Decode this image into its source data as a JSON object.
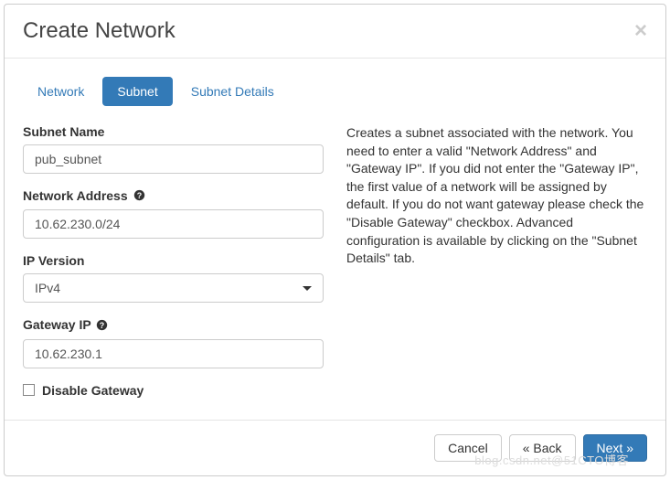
{
  "modal": {
    "title": "Create Network"
  },
  "tabs": {
    "network": "Network",
    "subnet": "Subnet",
    "subnet_details": "Subnet Details"
  },
  "form": {
    "subnet_name": {
      "label": "Subnet Name",
      "value": "pub_subnet"
    },
    "network_address": {
      "label": "Network Address",
      "value": "10.62.230.0/24"
    },
    "ip_version": {
      "label": "IP Version",
      "value": "IPv4"
    },
    "gateway_ip": {
      "label": "Gateway IP",
      "value": "10.62.230.1"
    },
    "disable_gateway": {
      "label": "Disable Gateway"
    }
  },
  "help_text": "Creates a subnet associated with the network. You need to enter a valid \"Network Address\" and \"Gateway IP\". If you did not enter the \"Gateway IP\", the first value of a network will be assigned by default. If you do not want gateway please check the \"Disable Gateway\" checkbox. Advanced configuration is available by clicking on the \"Subnet Details\" tab.",
  "footer": {
    "cancel": "Cancel",
    "back": "« Back",
    "next": "Next »"
  },
  "watermark": "blog.csdn.net@51CTO博客"
}
